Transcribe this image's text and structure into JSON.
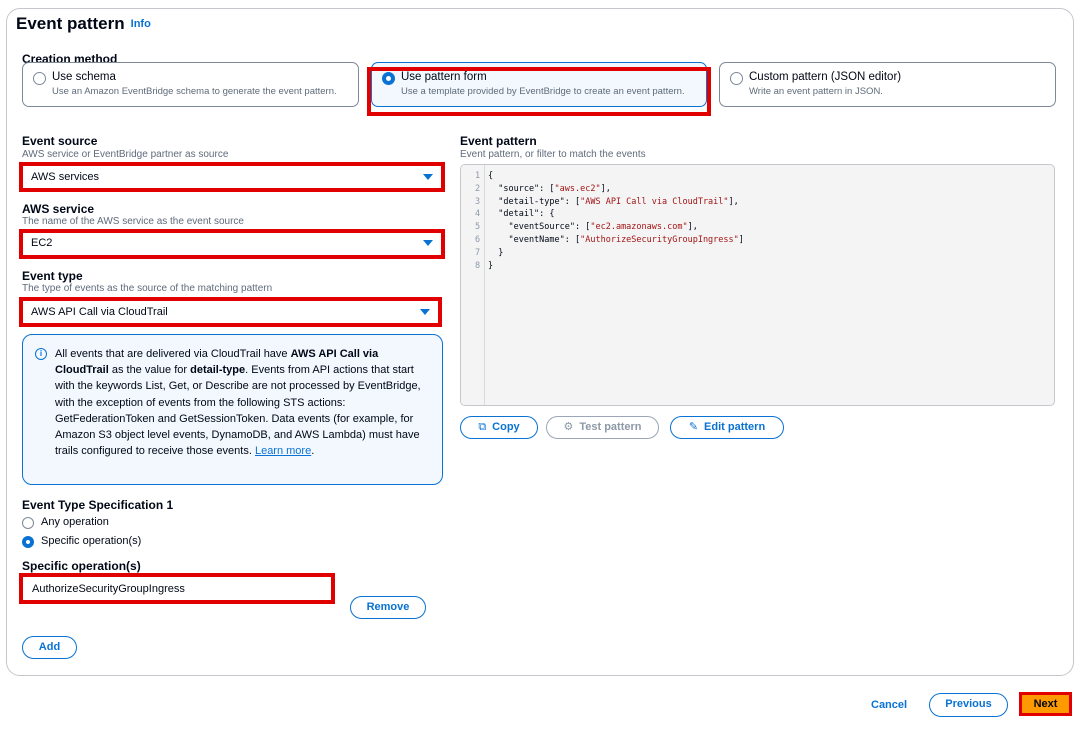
{
  "section": {
    "title": "Event pattern",
    "info": "Info"
  },
  "creation_method": {
    "label": "Creation method",
    "options": [
      {
        "title": "Use schema",
        "desc": "Use an Amazon EventBridge schema to generate the event pattern.",
        "selected": false
      },
      {
        "title": "Use pattern form",
        "desc": "Use a template provided by EventBridge to create an event pattern.",
        "selected": true
      },
      {
        "title": "Custom pattern (JSON editor)",
        "desc": "Write an event pattern in JSON.",
        "selected": false
      }
    ]
  },
  "event_source": {
    "label": "Event source",
    "desc": "AWS service or EventBridge partner as source",
    "value": "AWS services"
  },
  "aws_service": {
    "label": "AWS service",
    "desc": "The name of the AWS service as the event source",
    "value": "EC2"
  },
  "event_type": {
    "label": "Event type",
    "desc": "The type of events as the source of the matching pattern",
    "value": "AWS API Call via CloudTrail"
  },
  "info_alert": {
    "p1": "All events that are delivered via CloudTrail have ",
    "b1": "AWS API Call via CloudTrail",
    "p2": " as the value for ",
    "b2": "detail-type",
    "p3": ". Events from API actions that start with the keywords List, Get, or Describe are not processed by EventBridge, with the exception of events from the following STS actions: GetFederationToken and GetSessionToken. Data events (for example, for Amazon S3 object level events, DynamoDB, and AWS Lambda) must have trails configured to receive those events. ",
    "link": "Learn more",
    "end": "."
  },
  "spec": {
    "label": "Event Type Specification 1",
    "any": "Any operation",
    "specific": "Specific operation(s)",
    "ops_label": "Specific operation(s)",
    "ops_value": "AuthorizeSecurityGroupIngress",
    "remove": "Remove",
    "add": "Add"
  },
  "pattern": {
    "label": "Event pattern",
    "desc": "Event pattern, or filter to match the events",
    "lines": [
      {
        "n": "1",
        "pre": "{",
        "str": "",
        "post": ""
      },
      {
        "n": "2",
        "pre": "  \"source\": [",
        "str": "\"aws.ec2\"",
        "post": "],"
      },
      {
        "n": "3",
        "pre": "  \"detail-type\": [",
        "str": "\"AWS API Call via CloudTrail\"",
        "post": "],"
      },
      {
        "n": "4",
        "pre": "  \"detail\": {",
        "str": "",
        "post": ""
      },
      {
        "n": "5",
        "pre": "    \"eventSource\": [",
        "str": "\"ec2.amazonaws.com\"",
        "post": "],"
      },
      {
        "n": "6",
        "pre": "    \"eventName\": [",
        "str": "\"AuthorizeSecurityGroupIngress\"",
        "post": "]"
      },
      {
        "n": "7",
        "pre": "  }",
        "str": "",
        "post": ""
      },
      {
        "n": "8",
        "pre": "}",
        "str": "",
        "post": ""
      }
    ],
    "copy": "Copy",
    "test": "Test pattern",
    "edit": "Edit pattern"
  },
  "footer": {
    "cancel": "Cancel",
    "previous": "Previous",
    "next": "Next"
  },
  "colors": {
    "accent": "#0972d3",
    "highlight": "#e00000",
    "primary": "#ff9900"
  }
}
